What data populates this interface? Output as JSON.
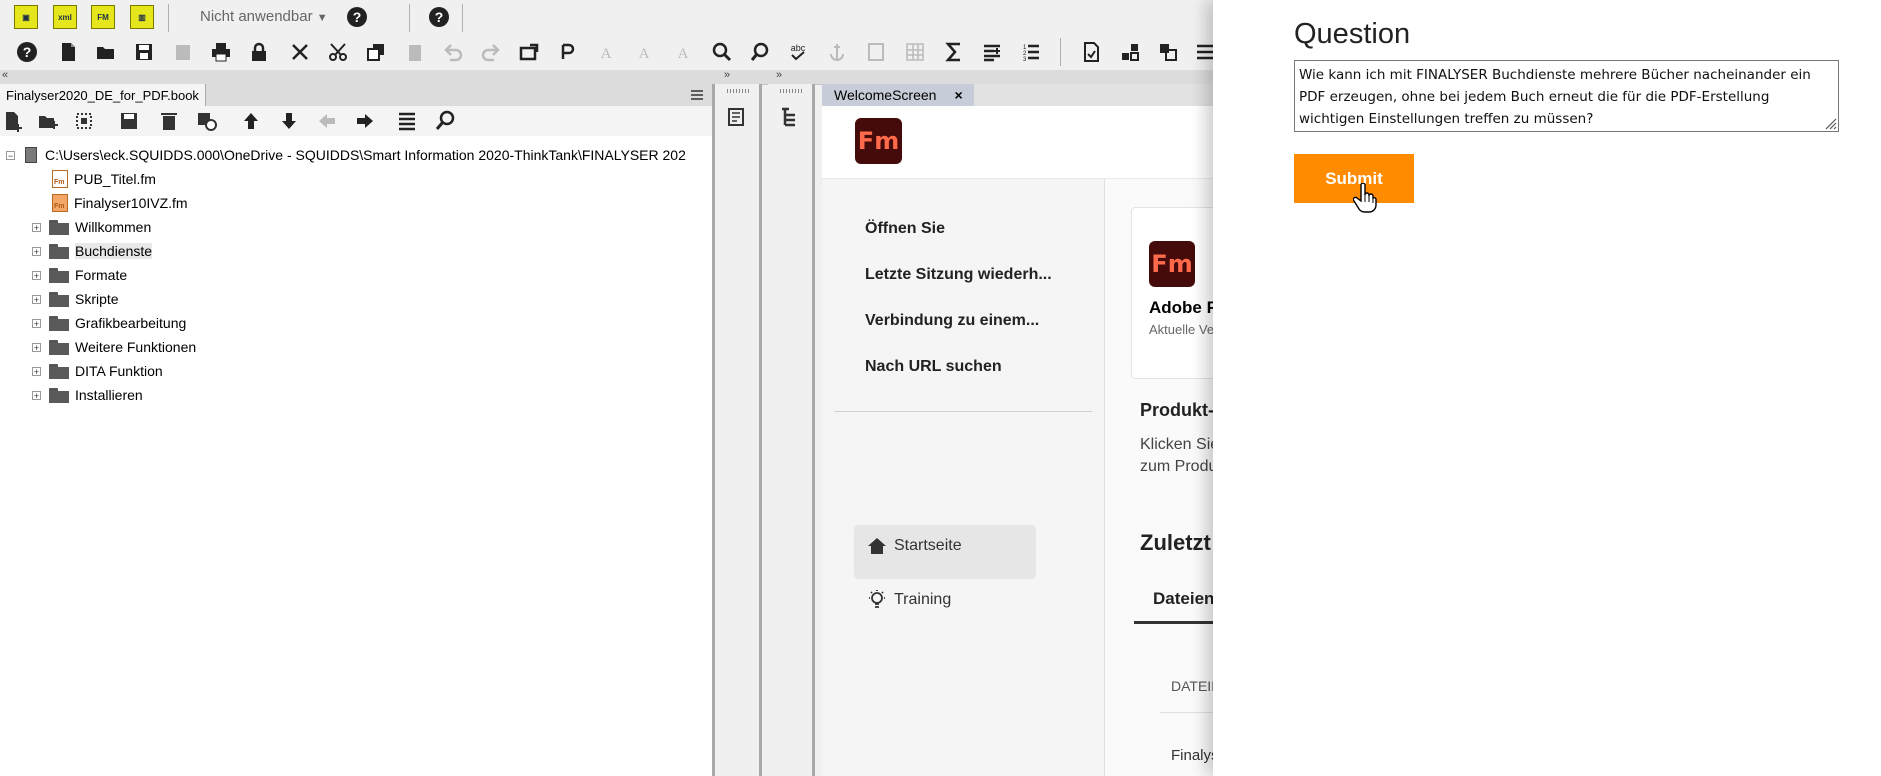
{
  "toolbar1": {
    "dropdown_value": "Nicht anwendbar",
    "icons": [
      "frame-icon",
      "xml-icon",
      "fm-icon",
      "layout-icon",
      "help-icon",
      "help-icon-2"
    ]
  },
  "toolbar2": {
    "icons": [
      "help-icon",
      "new-icon",
      "open-icon",
      "save-icon",
      "save-as-icon",
      "print-icon",
      "lock-icon",
      "close-icon",
      "cut-icon",
      "copy-icon",
      "paste-icon",
      "undo-icon",
      "redo-icon",
      "import-icon",
      "redo-alt-icon",
      "char-format-icon",
      "para-format-icon",
      "pgf-icon",
      "find-icon",
      "find-next-icon",
      "spell-check-icon",
      "anchor-icon",
      "insert-frame-icon",
      "table-icon",
      "sum-icon",
      "insert-variable-icon",
      "list-icon",
      "xref-icon",
      "conditional-icon",
      "hyperlink-icon",
      "structure-icon"
    ]
  },
  "book_panel": {
    "tab_label": "Finalyser2020_DE_for_PDF.book",
    "root_path": "C:\\Users\\eck.SQUIDDS.000\\OneDrive - SQUIDDS\\Smart Information 2020-ThinkTank\\FINALYSER 202",
    "files": [
      {
        "label": "PUB_Titel.fm",
        "icon": "fm-file-icon"
      },
      {
        "label": "Finalyser10IVZ.fm",
        "icon": "fm-file-filled-icon"
      }
    ],
    "folders": [
      "Willkommen",
      "Buchdienste",
      "Formate",
      "Skripte",
      "Grafikbearbeitung",
      "Weitere Funktionen",
      "DITA Funktion",
      "Installieren"
    ]
  },
  "welcome": {
    "tab_label": "WelcomeScreen",
    "tab_close": "×",
    "logo_text": "Fm",
    "nav_links": [
      "Öffnen Sie",
      "Letzte Sitzung wiederh...",
      "Verbindung zu einem...",
      "Nach URL suchen"
    ],
    "side_items": [
      {
        "label": "Startseite",
        "icon": "home-icon"
      },
      {
        "label": "Training",
        "icon": "lightbulb-icon"
      }
    ],
    "product_card": {
      "logo_text": "Fm",
      "title": "Adobe F",
      "subtitle": "Aktuelle Ve"
    },
    "product_heading": "Produkt-",
    "product_text_1": "Klicken Sie",
    "product_text_2": "zum Produ",
    "recent_heading": "Zuletzt v",
    "files_tab": "Dateien",
    "column_header": "DATEIN",
    "file_row": "Finalys"
  },
  "question": {
    "title": "Question",
    "text": "Wie kann ich mit FINALYSER Buchdienste mehrere Bücher nacheinander ein PDF erzeugen, ohne bei jedem Buch erneut die für die PDF-Erstellung wichtigen Einstellungen treffen zu müssen?",
    "submit_label": "Submit"
  },
  "colors": {
    "submit": "#ff8b00",
    "fm_logo_bg": "#450a0a",
    "fm_logo_text": "#ff6a4a",
    "welcome_tab": "#c7ccd9"
  }
}
